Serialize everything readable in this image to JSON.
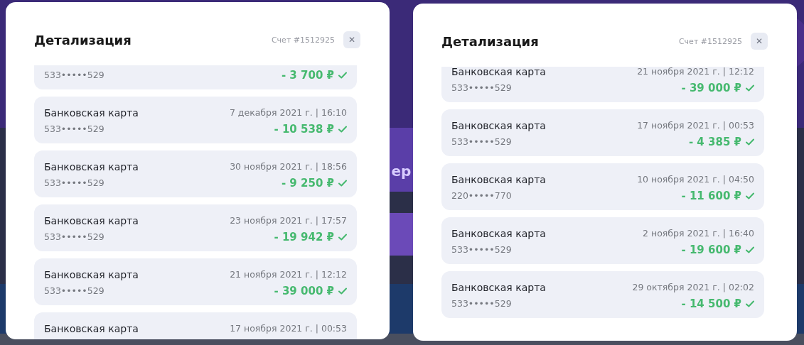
{
  "backdrop_text": "ер",
  "panels": [
    {
      "title": "Детализация",
      "account": "Счет #1512925",
      "close": "✕",
      "items": [
        {
          "number": "533•••••529",
          "amount": "- 3 700 ₽",
          "confirmed": true
        },
        {
          "name": "Банковская карта",
          "date": "7 декабря 2021 г. | 16:10",
          "number": "533•••••529",
          "amount": "- 10 538 ₽",
          "confirmed": true
        },
        {
          "name": "Банковская карта",
          "date": "30 ноября 2021 г. | 18:56",
          "number": "533•••••529",
          "amount": "- 9 250 ₽",
          "confirmed": true
        },
        {
          "name": "Банковская карта",
          "date": "23 ноября 2021 г. | 17:57",
          "number": "533•••••529",
          "amount": "- 19 942 ₽",
          "confirmed": true
        },
        {
          "name": "Банковская карта",
          "date": "21 ноября 2021 г. | 12:12",
          "number": "533•••••529",
          "amount": "- 39 000 ₽",
          "confirmed": true
        },
        {
          "name": "Банковская карта",
          "date": "17 ноября 2021 г. | 00:53"
        }
      ]
    },
    {
      "title": "Детализация",
      "account": "Счет #1512925",
      "close": "✕",
      "items": [
        {
          "name": "Банковская карта",
          "date": "21 ноября 2021 г. | 12:12",
          "number": "533•••••529",
          "amount": "- 39 000 ₽",
          "confirmed": true
        },
        {
          "name": "Банковская карта",
          "date": "17 ноября 2021 г. | 00:53",
          "number": "533•••••529",
          "amount": "- 4 385 ₽",
          "confirmed": true
        },
        {
          "name": "Банковская карта",
          "date": "10 ноября 2021 г. | 04:50",
          "number": "220•••••770",
          "amount": "- 11 600 ₽",
          "confirmed": true
        },
        {
          "name": "Банковская карта",
          "date": "2 ноября 2021 г. | 16:40",
          "number": "533•••••529",
          "amount": "- 19 600 ₽",
          "confirmed": true
        },
        {
          "name": "Банковская карта",
          "date": "29 октября 2021 г. | 02:02",
          "number": "533•••••529",
          "amount": "- 14 500 ₽",
          "confirmed": true
        }
      ]
    }
  ]
}
